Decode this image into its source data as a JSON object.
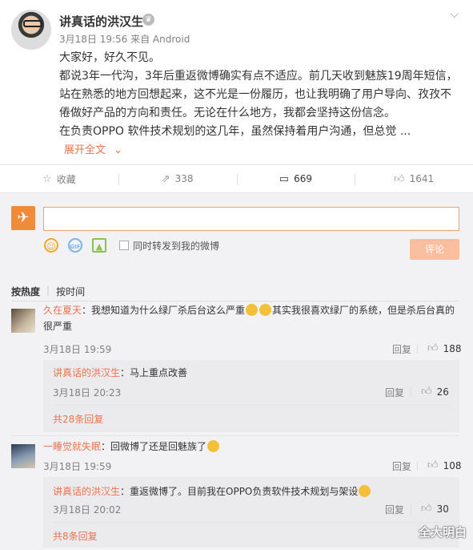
{
  "post": {
    "username": "讲真话的洪汉生",
    "meta": "3月18日 19:56 来自 Android",
    "lines": [
      "大家好，好久不见。",
      "都说3年一代沟，3年后重返微博确实有点不适应。前几天收到魅族19周年短信，",
      "站在熟悉的地方回想起来，这不光是一份履历，也让我明确了用户导向、孜孜不",
      "倦做好产品的方向和责任。无论在什么地方，我都会坚持这份信念。",
      "在负责OPPO 软件技术规划的这几年，虽然保持着用户沟通，但总觉 ..."
    ],
    "expand_label": "展开全文",
    "expand_icon": "chevron-down-icon"
  },
  "actions": {
    "favorite_label": "收藏",
    "forward_count": "338",
    "comment_count": "669",
    "like_count": "1641"
  },
  "composer": {
    "forward_label": "同时转发到我的微博",
    "submit_label": "评论",
    "gif_label": "GIF"
  },
  "sort": {
    "hot": "按热度",
    "time": "按时间"
  },
  "comments": [
    {
      "name": "久在夏天",
      "text_a": "：我想知道为什么绿厂杀后台这么严重",
      "text_b": "其实我很喜欢绿厂的系统，但是杀后台真的",
      "text_c": "很严重",
      "time": "3月18日 19:59",
      "reply": "回复",
      "likes": "188",
      "sub": {
        "name": "讲真话的洪汉生",
        "text": "：马上重点改善",
        "time": "3月18日 20:23",
        "reply": "回复",
        "likes": "26"
      },
      "more": "共28条回复"
    },
    {
      "name": "一睡觉就失眠",
      "text_a": "：回微博了还是回魅族了",
      "time": "3月18日 19:59",
      "reply": "回复",
      "likes": "108",
      "sub": {
        "name": "讲真话的洪汉生",
        "text": "：重返微博了。目前我在OPPO负责软件技术规划与架设",
        "time": "3月18日 20:02",
        "reply": "回复",
        "likes": "30"
      },
      "more": "共8条回复"
    }
  ],
  "watermark": "全大明白"
}
